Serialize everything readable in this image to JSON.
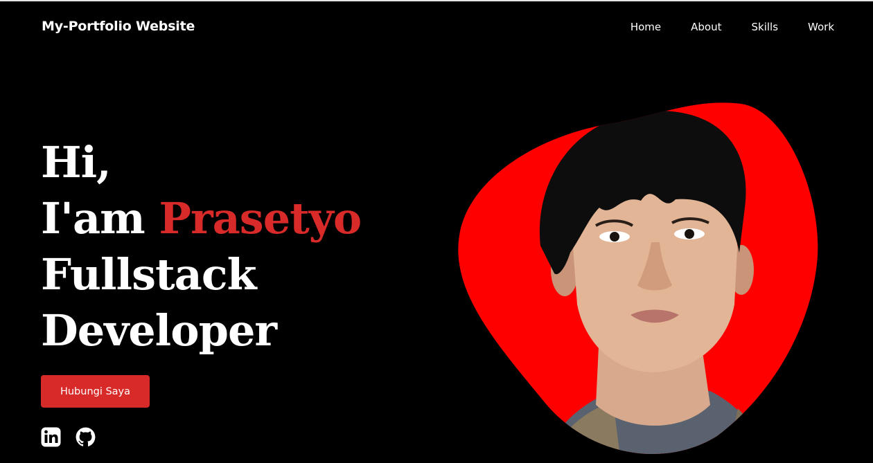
{
  "header": {
    "logo": "My-Portfolio Website",
    "nav": [
      "Home",
      "About",
      "Skills",
      "Work"
    ]
  },
  "hero": {
    "greeting": "Hi,",
    "intro_prefix": "I'am ",
    "name": "Prasetyo",
    "role_line1": "Fullstack",
    "role_line2": "Developer",
    "cta_label": "Hubungi Saya"
  },
  "social": {
    "icons": [
      "linkedin-icon",
      "github-icon"
    ]
  },
  "colors": {
    "background": "#000000",
    "accent": "#d92a2a",
    "blob": "#ff0000",
    "text": "#ffffff"
  }
}
